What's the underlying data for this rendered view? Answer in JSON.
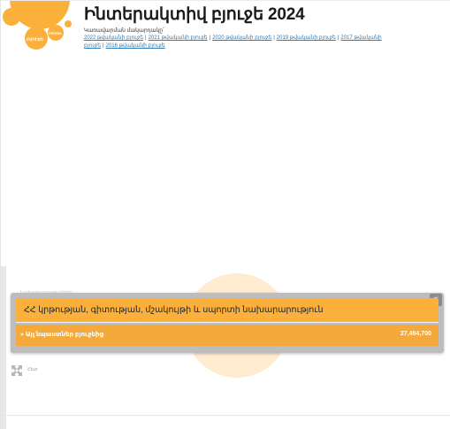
{
  "header": {
    "title": "Ինտերակտիվ բյուջե 2024",
    "subtitle": "Կառավարման մակարդակը՝ ",
    "logo_bubbles": [
      "ԲՅՈՒՋԵ",
      "ԲՅՈՒՋԵ"
    ],
    "year_links": [
      "2022 թվականի բյուջե",
      "2021 թվականի բյուջե",
      "2020 թվականի բյուջե",
      "2019 թվականի բյուջե",
      "2017 թվականի բյուջե",
      "2016 թվականի բյուջե"
    ],
    "separator": "|"
  },
  "background": {
    "faint_label": "Նախարարություններ"
  },
  "popup": {
    "title": "ՀՀ կրթության, գիտության, մշակույթի և սպորտի նախարարություն",
    "close_symbol": "×",
    "row_label": "» Այլ նպաստներ բյուջեից",
    "row_value": "27,464,700"
  },
  "controls": {
    "back_label": "Հետ"
  },
  "colors": {
    "accent": "#fbb03b",
    "accent_dark": "#f4a93a",
    "link": "#2a7ab8",
    "popup_frame": "#bdbdbd",
    "close_bg": "#8c8c8c"
  }
}
